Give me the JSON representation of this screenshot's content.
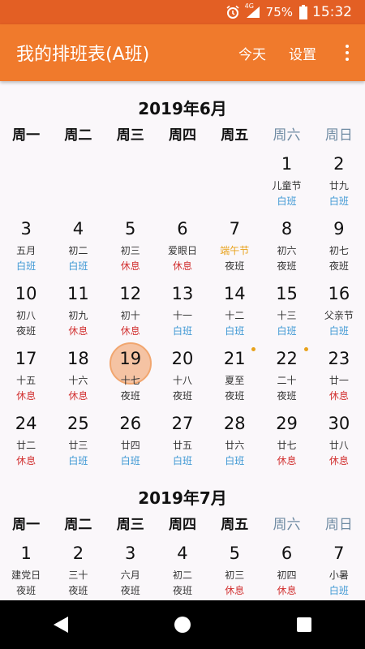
{
  "status_bar": {
    "network": "4G",
    "battery": "75%",
    "time": "15:32"
  },
  "app_bar": {
    "title": "我的排班表(A班)",
    "today_label": "今天",
    "settings_label": "设置"
  },
  "colors": {
    "primary": "#f07a2c",
    "status_bar": "#e35f24",
    "day_shift": "#3e98d4",
    "rest": "#d23232",
    "festival": "#e8a21b",
    "weekend_header": "#6f8ba3",
    "today_highlight": "#f5c3a3"
  },
  "weekdays": [
    "周一",
    "周二",
    "周三",
    "周四",
    "周五",
    "周六",
    "周日"
  ],
  "months": [
    {
      "title": "2019年6月",
      "days": [
        {
          "day": "",
          "lunar": "",
          "shift": ""
        },
        {
          "day": "",
          "lunar": "",
          "shift": ""
        },
        {
          "day": "",
          "lunar": "",
          "shift": ""
        },
        {
          "day": "",
          "lunar": "",
          "shift": ""
        },
        {
          "day": "",
          "lunar": "",
          "shift": ""
        },
        {
          "day": "1",
          "lunar": "儿童节",
          "shift": "白班"
        },
        {
          "day": "2",
          "lunar": "廿九",
          "shift": "白班"
        },
        {
          "day": "3",
          "lunar": "五月",
          "shift": "白班"
        },
        {
          "day": "4",
          "lunar": "初二",
          "shift": "白班"
        },
        {
          "day": "5",
          "lunar": "初三",
          "shift": "休息"
        },
        {
          "day": "6",
          "lunar": "爱眼日",
          "shift": "休息"
        },
        {
          "day": "7",
          "lunar": "端午节",
          "shift": "夜班",
          "festival": true
        },
        {
          "day": "8",
          "lunar": "初六",
          "shift": "夜班"
        },
        {
          "day": "9",
          "lunar": "初七",
          "shift": "夜班"
        },
        {
          "day": "10",
          "lunar": "初八",
          "shift": "夜班"
        },
        {
          "day": "11",
          "lunar": "初九",
          "shift": "休息"
        },
        {
          "day": "12",
          "lunar": "初十",
          "shift": "休息"
        },
        {
          "day": "13",
          "lunar": "十一",
          "shift": "白班"
        },
        {
          "day": "14",
          "lunar": "十二",
          "shift": "白班"
        },
        {
          "day": "15",
          "lunar": "十三",
          "shift": "白班"
        },
        {
          "day": "16",
          "lunar": "父亲节",
          "shift": "白班"
        },
        {
          "day": "17",
          "lunar": "十五",
          "shift": "休息"
        },
        {
          "day": "18",
          "lunar": "十六",
          "shift": "休息"
        },
        {
          "day": "19",
          "lunar": "十七",
          "shift": "夜班",
          "today": true
        },
        {
          "day": "20",
          "lunar": "十八",
          "shift": "夜班"
        },
        {
          "day": "21",
          "lunar": "夏至",
          "shift": "夜班",
          "dot": true
        },
        {
          "day": "22",
          "lunar": "二十",
          "shift": "夜班",
          "dot": true
        },
        {
          "day": "23",
          "lunar": "廿一",
          "shift": "休息"
        },
        {
          "day": "24",
          "lunar": "廿二",
          "shift": "休息"
        },
        {
          "day": "25",
          "lunar": "廿三",
          "shift": "白班"
        },
        {
          "day": "26",
          "lunar": "廿四",
          "shift": "白班"
        },
        {
          "day": "27",
          "lunar": "廿五",
          "shift": "白班"
        },
        {
          "day": "28",
          "lunar": "廿六",
          "shift": "白班"
        },
        {
          "day": "29",
          "lunar": "廿七",
          "shift": "休息"
        },
        {
          "day": "30",
          "lunar": "廿八",
          "shift": "休息"
        }
      ]
    },
    {
      "title": "2019年7月",
      "days": [
        {
          "day": "1",
          "lunar": "建党日",
          "shift": "夜班"
        },
        {
          "day": "2",
          "lunar": "三十",
          "shift": "夜班"
        },
        {
          "day": "3",
          "lunar": "六月",
          "shift": "夜班"
        },
        {
          "day": "4",
          "lunar": "初二",
          "shift": "夜班"
        },
        {
          "day": "5",
          "lunar": "初三",
          "shift": "休息"
        },
        {
          "day": "6",
          "lunar": "初四",
          "shift": "休息"
        },
        {
          "day": "7",
          "lunar": "小暑",
          "shift": "白班"
        }
      ]
    }
  ]
}
